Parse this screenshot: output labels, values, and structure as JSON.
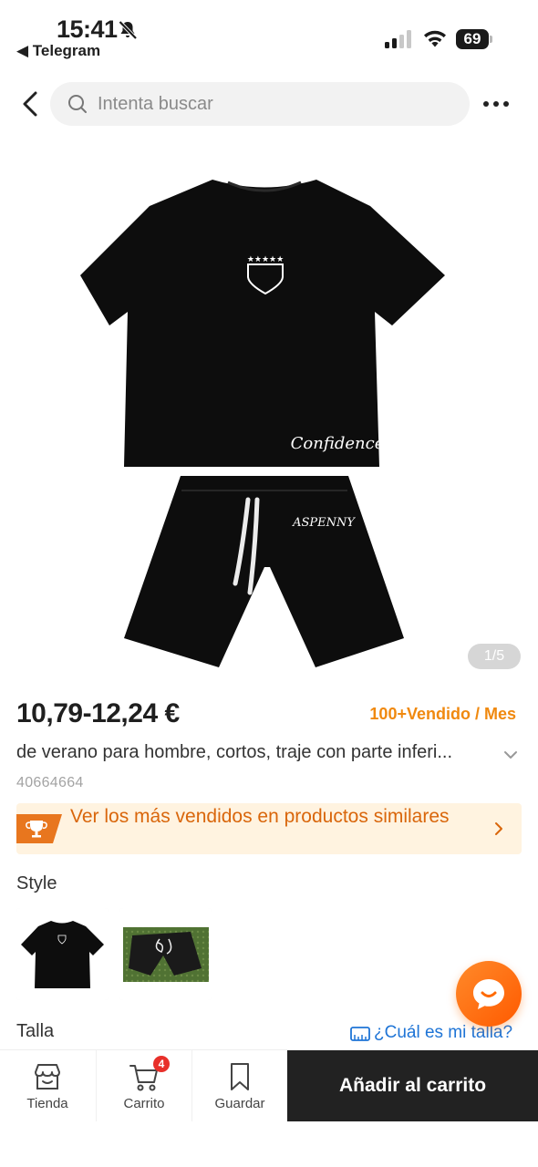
{
  "status_bar": {
    "time": "15:41",
    "back_app": "◀ Telegram",
    "battery": "69"
  },
  "search": {
    "placeholder": "Intenta buscar"
  },
  "gallery": {
    "counter": "1/5",
    "shirt_script": "Confidence",
    "shorts_script": "ASPENNY"
  },
  "product": {
    "price": "10,79-12,24 €",
    "sold": "100+Vendido / Mes",
    "title": "de verano para hombre, cortos, traje con parte inferi...",
    "id": "40664664"
  },
  "banner": {
    "text": "Ver los más vendidos en productos similares"
  },
  "style": {
    "label": "Style"
  },
  "size": {
    "label": "Talla",
    "guide": "¿Cuál es mi talla?"
  },
  "bottom_bar": {
    "store_label": "Tienda",
    "cart_label": "Carrito",
    "cart_count": "4",
    "save_label": "Guardar",
    "add_to_cart": "Añadir al carrito"
  },
  "colors": {
    "accent": "#ff6a00",
    "banner_text": "#d9660b",
    "sold_text": "#f0890f",
    "link": "#1e74d6",
    "button_dark": "#222222"
  },
  "icons": [
    "bell-slash-icon",
    "signal-icon",
    "wifi-icon",
    "battery-icon",
    "back-arrow-icon",
    "search-icon",
    "more-icon",
    "chevron-down-icon",
    "trophy-icon",
    "chevron-right-icon",
    "ruler-icon",
    "chat-icon",
    "store-icon",
    "cart-icon",
    "bookmark-icon"
  ]
}
